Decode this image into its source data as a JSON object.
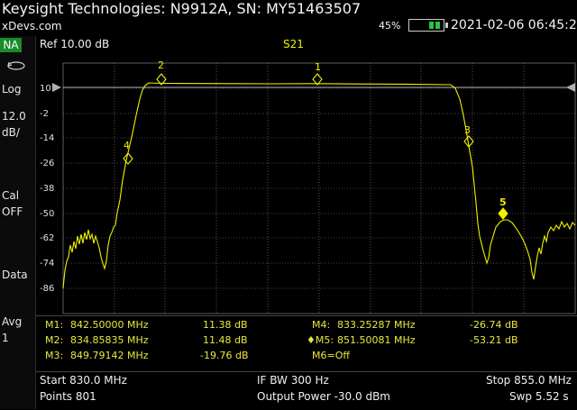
{
  "header": {
    "title": "Keysight Technologies: N9912A, SN: MY51463507",
    "host": "xDevs.com",
    "battery_percent": "45%",
    "battery_level": 0.45,
    "datetime": "2021-02-06 06:45:25"
  },
  "sidebar": {
    "mode": "NA",
    "items": [
      {
        "label": "Log"
      },
      {
        "label": "12.0"
      },
      {
        "label": "dB/"
      },
      {
        "label": "Cal"
      },
      {
        "label": "OFF"
      },
      {
        "label": "Data"
      },
      {
        "label": "Avg"
      },
      {
        "label": "1"
      }
    ]
  },
  "plot": {
    "ref": "Ref 10.00 dB",
    "trace": "S21",
    "ytick_labels": [
      "10",
      "-2",
      "-14",
      "-26",
      "-38",
      "-50",
      "-62",
      "-74",
      "-86"
    ]
  },
  "markers": {
    "rows": [
      {
        "name": "M1:",
        "freq": "842.50000 MHz",
        "value": "11.38 dB"
      },
      {
        "name": "M2:",
        "freq": "834.85835 MHz",
        "value": "11.48 dB"
      },
      {
        "name": "M3:",
        "freq": "849.79142 MHz",
        "value": "-19.76 dB"
      },
      {
        "name": "M4:",
        "freq": "833.25287 MHz",
        "value": "-26.74 dB"
      },
      {
        "name": "♦M5:",
        "freq": "851.50081 MHz",
        "value": "-53.21 dB"
      },
      {
        "name": "M6=Off",
        "freq": "",
        "value": ""
      }
    ],
    "plot_labels": [
      "1",
      "2",
      "3",
      "4",
      "5"
    ]
  },
  "footer": {
    "start": "Start 830.0 MHz",
    "ifbw": "IF BW 300 Hz",
    "stop": "Stop 855.0 MHz",
    "points": "Points 801",
    "power": "Output Power -30.0 dBm",
    "sweep": "Swp 5.52 s"
  },
  "colors": {
    "trace": "#f0f000",
    "grid": "#8a8a8a",
    "accent": "#1a8c2a"
  }
}
